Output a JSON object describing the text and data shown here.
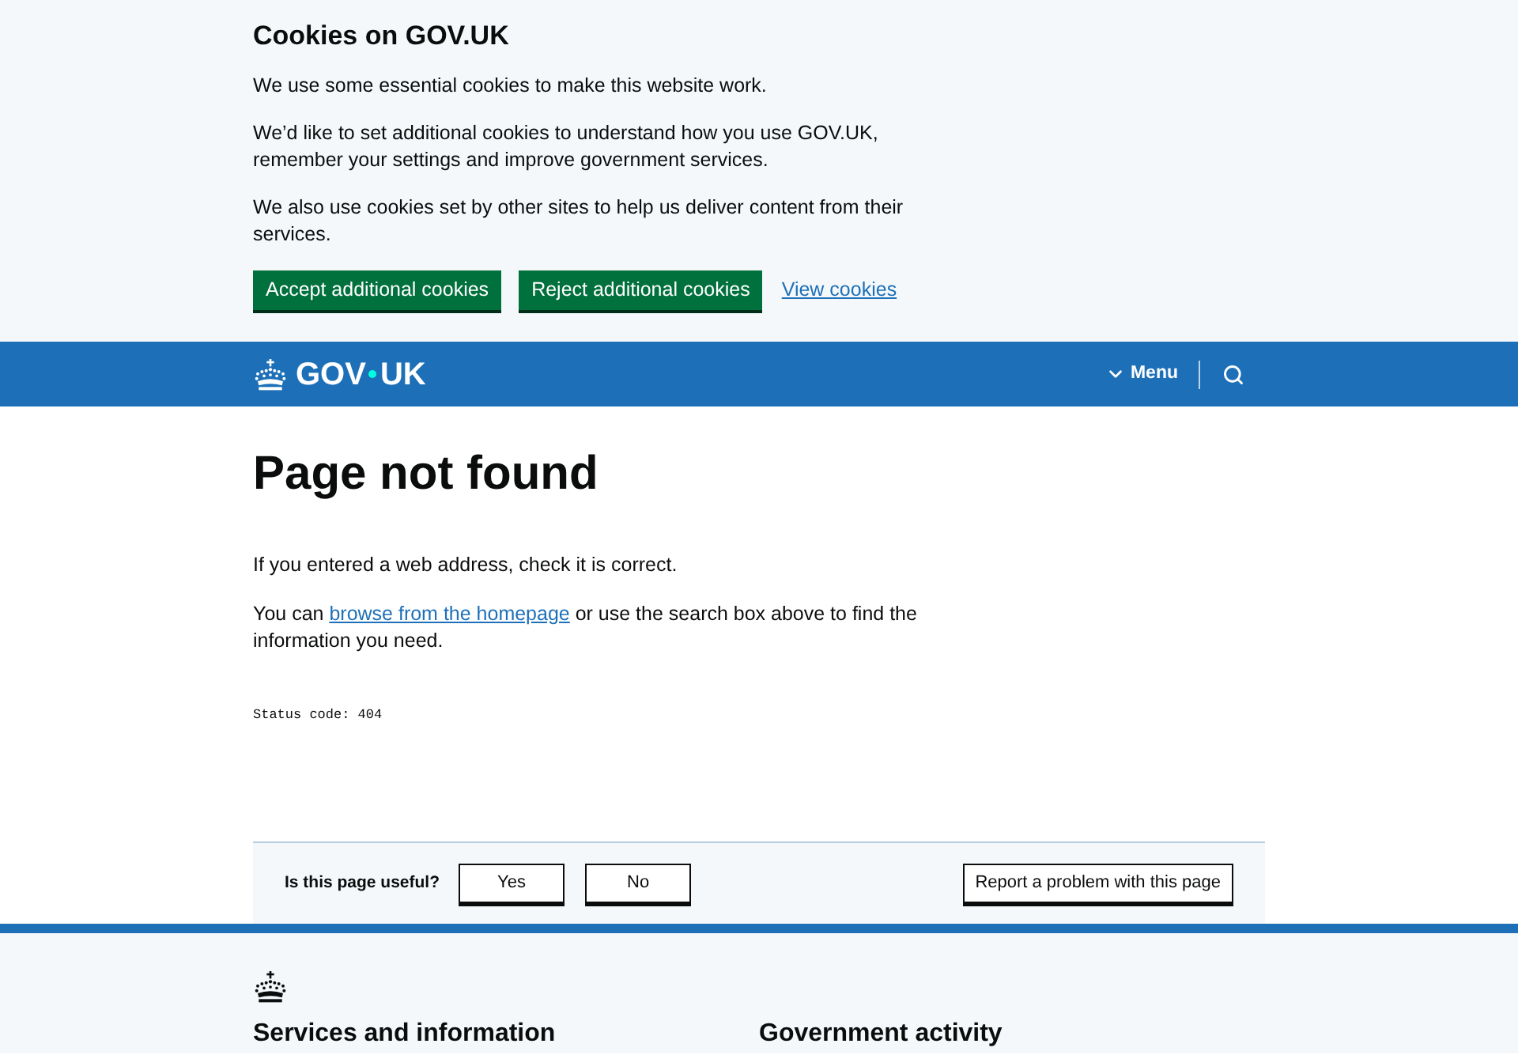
{
  "cookie_banner": {
    "title": "Cookies on GOV.UK",
    "paragraphs": [
      "We use some essential cookies to make this website work.",
      "We’d like to set additional cookies to understand how you use GOV.UK, remember your settings and improve government services.",
      "We also use cookies set by other sites to help us deliver content from their services."
    ],
    "actions": [
      {
        "label": "Accept additional cookies",
        "kind": "button"
      },
      {
        "label": "Reject additional cookies",
        "kind": "button"
      },
      {
        "label": "View cookies",
        "kind": "link"
      }
    ]
  },
  "header": {
    "logo": [
      "GOV",
      "UK"
    ],
    "menu": "Menu"
  },
  "main": {
    "title": "Page not found",
    "paragraphs": [
      {
        "before": "If you entered a web address, check it is correct."
      },
      {
        "before": "You can ",
        "link": "browse from the homepage",
        "after": " or use the search box above to find the information you need."
      }
    ],
    "status_code": "Status code: 404"
  },
  "feedback": {
    "question": "Is this page useful?",
    "answers": [
      "Yes",
      "No"
    ],
    "report": "Report a problem with this page"
  },
  "footer": {
    "sections": [
      "Services and information",
      "Government activity"
    ]
  }
}
